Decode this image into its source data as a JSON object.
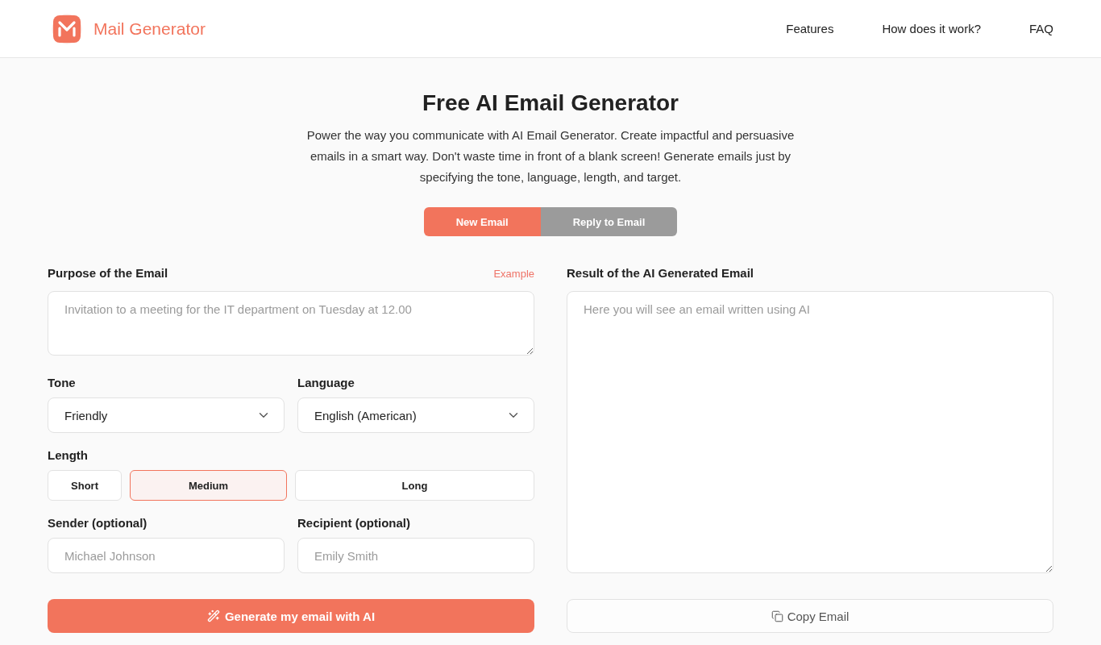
{
  "header": {
    "logo_text": "Mail Generator",
    "nav": [
      "Features",
      "How does it work?",
      "FAQ"
    ]
  },
  "hero": {
    "title": "Free AI Email Generator",
    "description": "Power the way you communicate with AI Email Generator. Create impactful and persuasive emails in a smart way. Don't waste time in front of a blank screen! Generate emails just by specifying the tone, language, length, and target."
  },
  "mode_tabs": [
    {
      "label": "New Email",
      "selected": true
    },
    {
      "label": "Reply to Email",
      "selected": false
    }
  ],
  "form": {
    "purpose": {
      "label": "Purpose of the Email",
      "example_link": "Example",
      "placeholder": "Invitation to a meeting for the IT department on Tuesday at 12.00"
    },
    "tone": {
      "label": "Tone",
      "value": "Friendly"
    },
    "language": {
      "label": "Language",
      "value": "English (American)"
    },
    "length": {
      "label": "Length",
      "options": [
        {
          "label": "Short",
          "selected": false
        },
        {
          "label": "Medium",
          "selected": true
        },
        {
          "label": "Long",
          "selected": false
        }
      ]
    },
    "sender": {
      "label": "Sender (optional)",
      "placeholder": "Michael Johnson"
    },
    "recipient": {
      "label": "Recipient (optional)",
      "placeholder": "Emily Smith"
    },
    "generate_button": "Generate my email with AI"
  },
  "result": {
    "label": "Result of the AI Generated Email",
    "placeholder": "Here you will see an email written using AI",
    "copy_button": "Copy Email"
  }
}
